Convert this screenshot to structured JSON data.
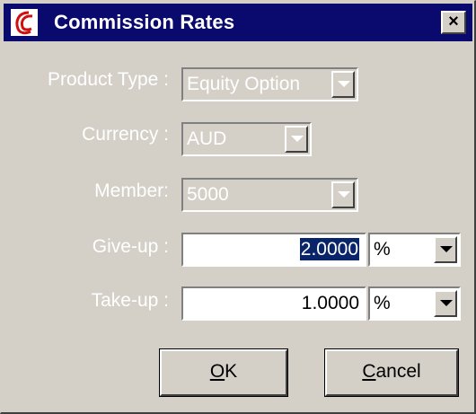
{
  "window": {
    "title": "Commission Rates",
    "close_glyph": "×",
    "icon": "app-logo-icon"
  },
  "form": {
    "product_type": {
      "label": "Product Type :",
      "value": "Equity Option"
    },
    "currency": {
      "label": "Currency :",
      "value": "AUD"
    },
    "member": {
      "label": "Member:",
      "value": "5000"
    },
    "give_up": {
      "label": "Give-up :",
      "value": "2.0000",
      "unit": "%"
    },
    "take_up": {
      "label": "Take-up :",
      "value": "1.0000",
      "unit": "%"
    }
  },
  "buttons": {
    "ok": {
      "mnemonic": "O",
      "rest": "K"
    },
    "cancel": {
      "mnemonic": "C",
      "rest": "ancel"
    }
  },
  "colors": {
    "title_bar": "#0a0a6e",
    "face": "#d4d0c8",
    "selection": "#0a246a"
  }
}
